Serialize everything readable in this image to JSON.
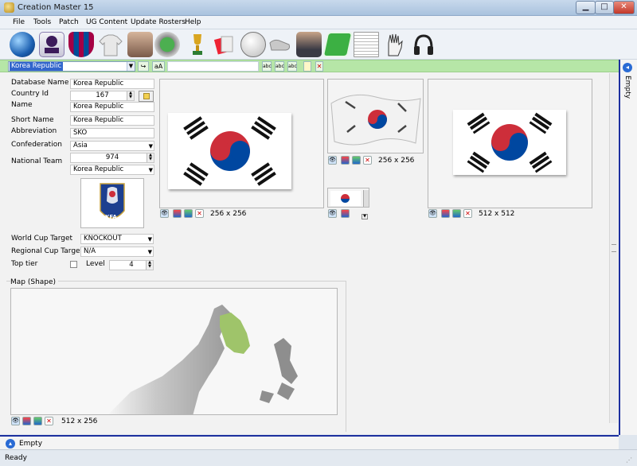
{
  "window": {
    "title": "Creation Master 15"
  },
  "menu": [
    "File",
    "Tools",
    "Patch",
    "UG Content",
    "Update Rosters",
    "Help"
  ],
  "toolbar_icons": [
    "globe-icon",
    "premier-league-icon",
    "club-crest-icon",
    "kit-icon",
    "player-icon",
    "stadium-icon",
    "trophy-icon",
    "referee-card-icon",
    "ball-icon",
    "boot-icon",
    "manager-icon",
    "pitch-icon",
    "newspaper-icon",
    "goalkeeper-glove-icon",
    "headphones-icon"
  ],
  "search": {
    "selected": "Korea Republic",
    "case_btn": "aA"
  },
  "form": {
    "database_name_label": "Database Name",
    "database_name": "Korea Republic",
    "country_id_label": "Country Id",
    "country_id": "167",
    "name_label": "Name",
    "name": "Korea Republic",
    "short_name_label": "Short Name",
    "short_name": "Korea Republic",
    "abbreviation_label": "Abbreviation",
    "abbreviation": "SKO",
    "confederation_label": "Confederation",
    "confederation": "Asia",
    "national_team_label": "National Team",
    "national_team_id": "974",
    "national_team_name": "Korea Republic",
    "world_cup_target_label": "World Cup Target",
    "world_cup_target": "KNOCKOUT",
    "regional_cup_target_label": "Regional Cup Target",
    "regional_cup_target": "N/A",
    "top_tier_label": "Top tier",
    "level_label": "Level",
    "level": "4"
  },
  "crest": {
    "text": "KFA"
  },
  "images": {
    "flag_large_size": "256 x 256",
    "flag_wave_size": "256 x 256",
    "flag_512_size": "512 x 512",
    "map_label": "Map (Shape)",
    "map_size": "512 x 256"
  },
  "right_panel": {
    "label": "Empty"
  },
  "bottom_panel": {
    "label": "Empty"
  },
  "status": {
    "text": "Ready"
  },
  "colors": {
    "flag_red": "#cd2e3a",
    "flag_blue": "#0047a0",
    "accent_blue": "#1c2f9e",
    "search_green": "#b6e6a7",
    "map_highlight": "#9fc46a"
  }
}
